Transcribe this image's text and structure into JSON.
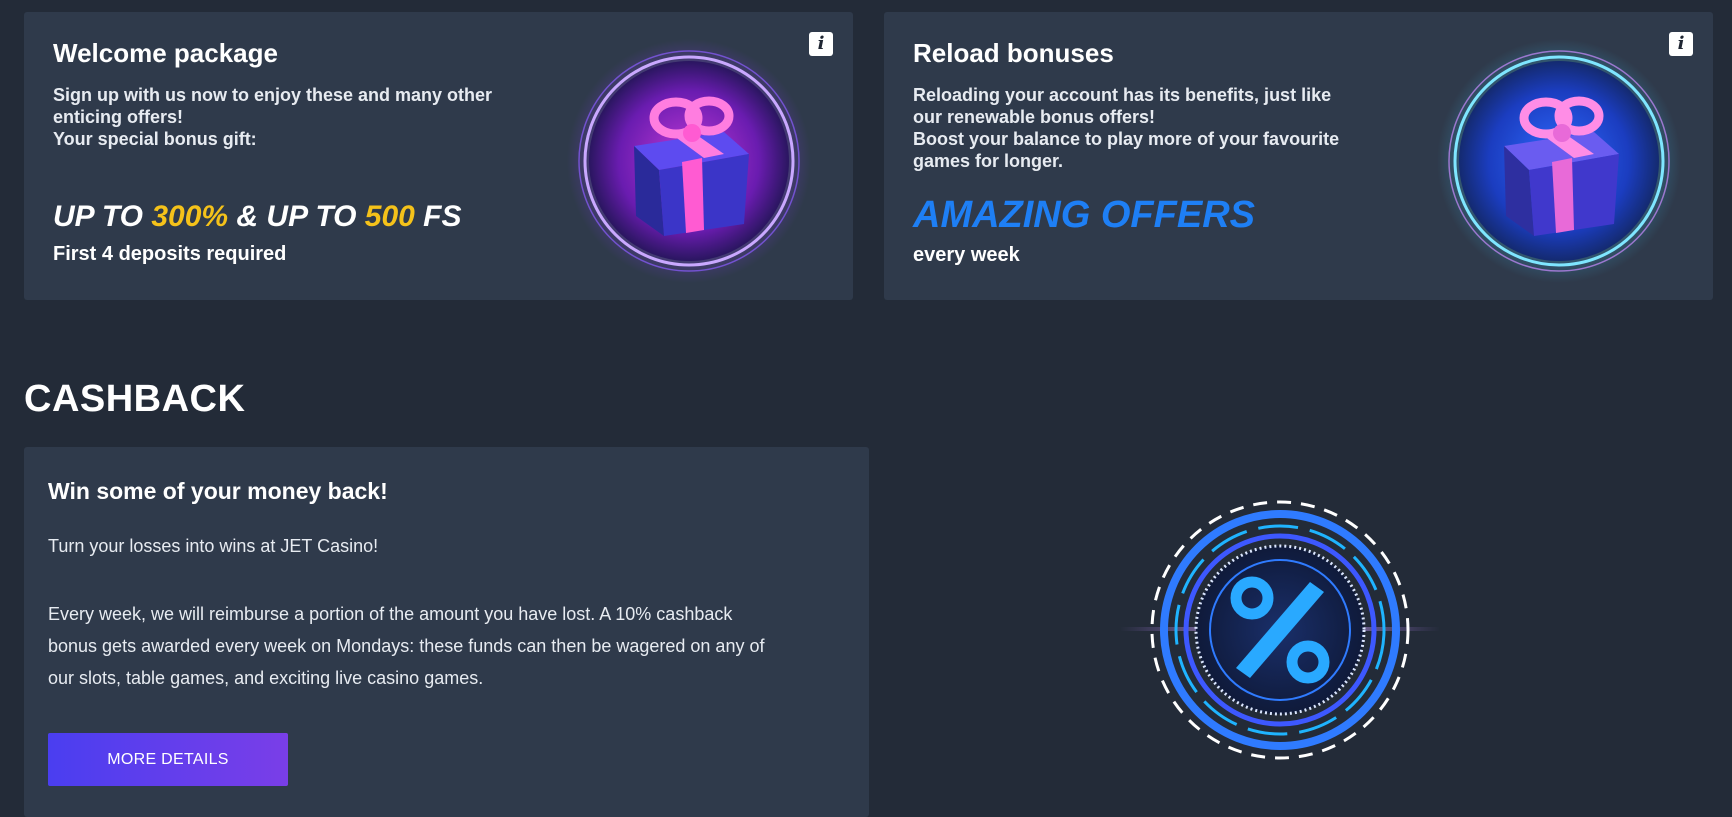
{
  "welcome": {
    "title": "Welcome package",
    "desc_lines": [
      "Sign up with us now to enjoy these and many other",
      "enticing offers!",
      "Your special bonus gift:"
    ],
    "promo": {
      "part1": "UP TO ",
      "highlight1": "300%",
      "part2": " & UP TO ",
      "highlight2": "500",
      "part3": " FS"
    },
    "sub": "First 4 deposits required",
    "info_label": "i",
    "gift_icon": "gift-icon"
  },
  "reload": {
    "title": "Reload bonuses",
    "desc_lines": [
      "Reloading your account has its benefits, just like",
      "our renewable bonus offers!",
      "Boost your balance to play more of your favourite",
      "games for longer."
    ],
    "highlight": "AMAZING OFFERS",
    "sub": "every week",
    "info_label": "i",
    "gift_icon": "gift-icon"
  },
  "cashback": {
    "heading": "CASHBACK",
    "title": "Win some of your money back!",
    "p1": "Turn your losses into wins at JET Casino!",
    "p2_lines": [
      "Every week, we will reimburse a portion of the amount you have lost. A 10% cashback",
      "bonus gets awarded every week on Mondays: these funds can then be wagered on any of",
      "our slots, table games, and exciting live casino games."
    ],
    "button": "MORE DETAILS",
    "art_icon": "percent-icon"
  },
  "colors": {
    "background": "#232b38",
    "card": "#2f3a4b",
    "yellow": "#f5c21a",
    "blue": "#1e7ff5",
    "button_start": "#4a3ef0",
    "button_end": "#7a3ee8"
  }
}
